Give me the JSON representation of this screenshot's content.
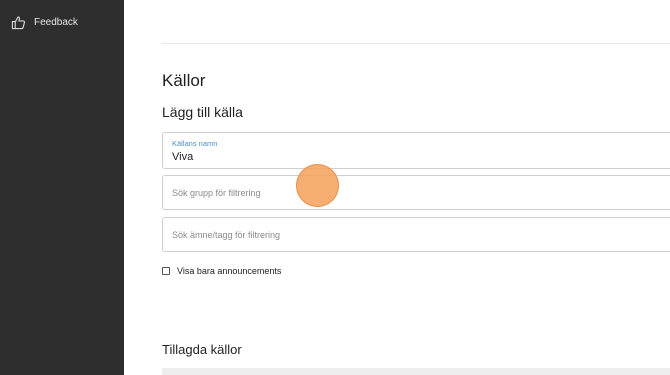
{
  "sidebar": {
    "items": [
      {
        "label": "Feedback",
        "icon": "thumbs-up-icon"
      }
    ]
  },
  "main": {
    "page_title": "Källor",
    "section_title": "Lägg till källa",
    "source_name": {
      "label": "Källans namn",
      "value": "Viva"
    },
    "group_search": {
      "placeholder": "Sök grupp för filtrering"
    },
    "topic_search": {
      "placeholder": "Sök ämne/tagg för filtrering"
    },
    "announcements_checkbox": {
      "label": "Visa bara announcements",
      "checked": false
    },
    "added_sources_title": "Tillagda källor"
  },
  "colors": {
    "sidebar_bg": "#2e2e2e",
    "accent": "#4a90c8",
    "cursor_highlight": "#f5a05a"
  }
}
